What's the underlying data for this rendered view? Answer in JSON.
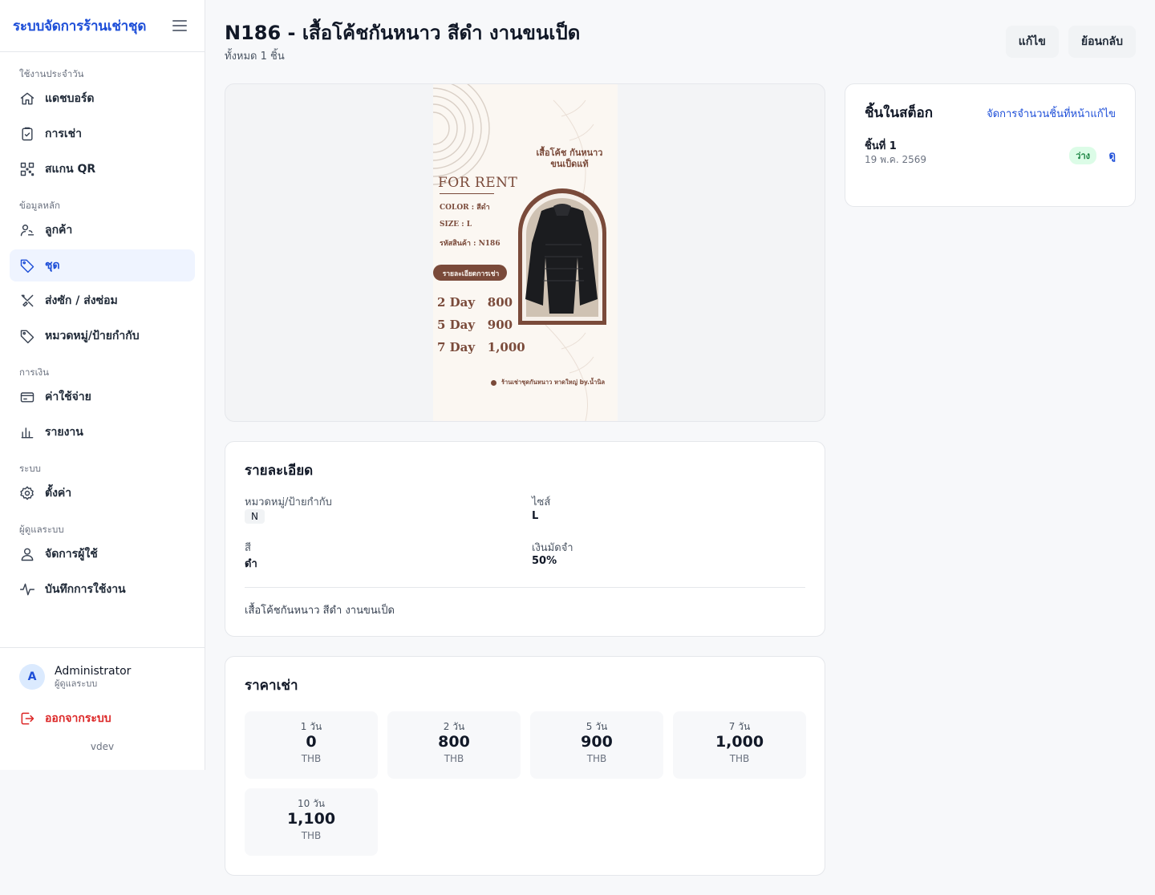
{
  "app": {
    "title": "ระบบจัดการร้านเช่าชุด",
    "version": "vdev"
  },
  "sidebar": {
    "sections": [
      {
        "label": "ใช้งานประจำวัน",
        "items": [
          {
            "label": "แดชบอร์ด",
            "icon": "home-icon"
          },
          {
            "label": "การเช่า",
            "icon": "clipboard-check-icon"
          },
          {
            "label": "สแกน QR",
            "icon": "qr-scan-icon"
          }
        ]
      },
      {
        "label": "ข้อมูลหลัก",
        "items": [
          {
            "label": "ลูกค้า",
            "icon": "users-icon"
          },
          {
            "label": "ชุด",
            "icon": "tag-icon",
            "active": true
          },
          {
            "label": "ส่งซัก / ส่งซ่อม",
            "icon": "tools-icon"
          },
          {
            "label": "หมวดหมู่/ป้ายกำกับ",
            "icon": "label-icon"
          }
        ]
      },
      {
        "label": "การเงิน",
        "items": [
          {
            "label": "ค่าใช้จ่าย",
            "icon": "credit-card-icon"
          },
          {
            "label": "รายงาน",
            "icon": "bar-chart-icon"
          }
        ]
      },
      {
        "label": "ระบบ",
        "items": [
          {
            "label": "ตั้งค่า",
            "icon": "gear-icon"
          }
        ]
      },
      {
        "label": "ผู้ดูแลระบบ",
        "items": [
          {
            "label": "จัดการผู้ใช้",
            "icon": "user-icon"
          },
          {
            "label": "บันทึกการใช้งาน",
            "icon": "activity-icon"
          }
        ]
      }
    ],
    "user": {
      "initial": "A",
      "name": "Administrator",
      "role": "ผู้ดูแลระบบ"
    },
    "logout_label": "ออกจากระบบ"
  },
  "page": {
    "title": "N186 - เสื้อโค้ชกันหนาว สีดำ งานขนเป็ด",
    "subtitle": "ทั้งหมด 1 ชิ้น",
    "edit_label": "แก้ไข",
    "back_label": "ย้อนกลับ"
  },
  "poster": {
    "heading_line1": "เสื้อโค้ช กันหนาว",
    "heading_line2": "ขนเป็ดแท้",
    "for_rent": "FOR RENT",
    "color": "COLOR : สีดำ",
    "size": "SIZE : L",
    "code": "รหัสสินค้า : N186",
    "rent_detail": "รายละเอียดการเช่า",
    "prices": [
      "2 Day   800",
      "5 Day   900",
      "7 Day   1,000"
    ],
    "shop": "ร้านเช่าชุดกันหนาว หาดใหญ่ by.น้ำนิล"
  },
  "details": {
    "title": "รายละเอียด",
    "category_label": "หมวดหมู่/ป้ายกำกับ",
    "category_value": "N",
    "size_label": "ไซส์",
    "size_value": "L",
    "color_label": "สี",
    "color_value": "ดำ",
    "deposit_label": "เงินมัดจำ",
    "deposit_value": "50%",
    "description": "เสื้อโค้ชกันหนาว สีดำ งานขนเป็ด"
  },
  "pricing": {
    "title": "ราคาเช่า",
    "tiles": [
      {
        "duration": "1 วัน",
        "amount": "0",
        "currency": "THB"
      },
      {
        "duration": "2 วัน",
        "amount": "800",
        "currency": "THB"
      },
      {
        "duration": "5 วัน",
        "amount": "900",
        "currency": "THB"
      },
      {
        "duration": "7 วัน",
        "amount": "1,000",
        "currency": "THB"
      },
      {
        "duration": "10 วัน",
        "amount": "1,100",
        "currency": "THB"
      }
    ]
  },
  "stock": {
    "title": "ชิ้นในสต็อก",
    "manage_link": "จัดการจำนวนชิ้นที่หน้าแก้ไข",
    "items": [
      {
        "name": "ชิ้นที่ 1",
        "date": "19 พ.ค. 2569",
        "status": "ว่าง",
        "view_label": "ดู"
      }
    ]
  },
  "colors": {
    "accent": "#1d4ed8",
    "danger": "#dc2626",
    "success_bg": "#dcfce7",
    "success_text": "#15803d",
    "poster_brown": "#7a4a3a"
  }
}
